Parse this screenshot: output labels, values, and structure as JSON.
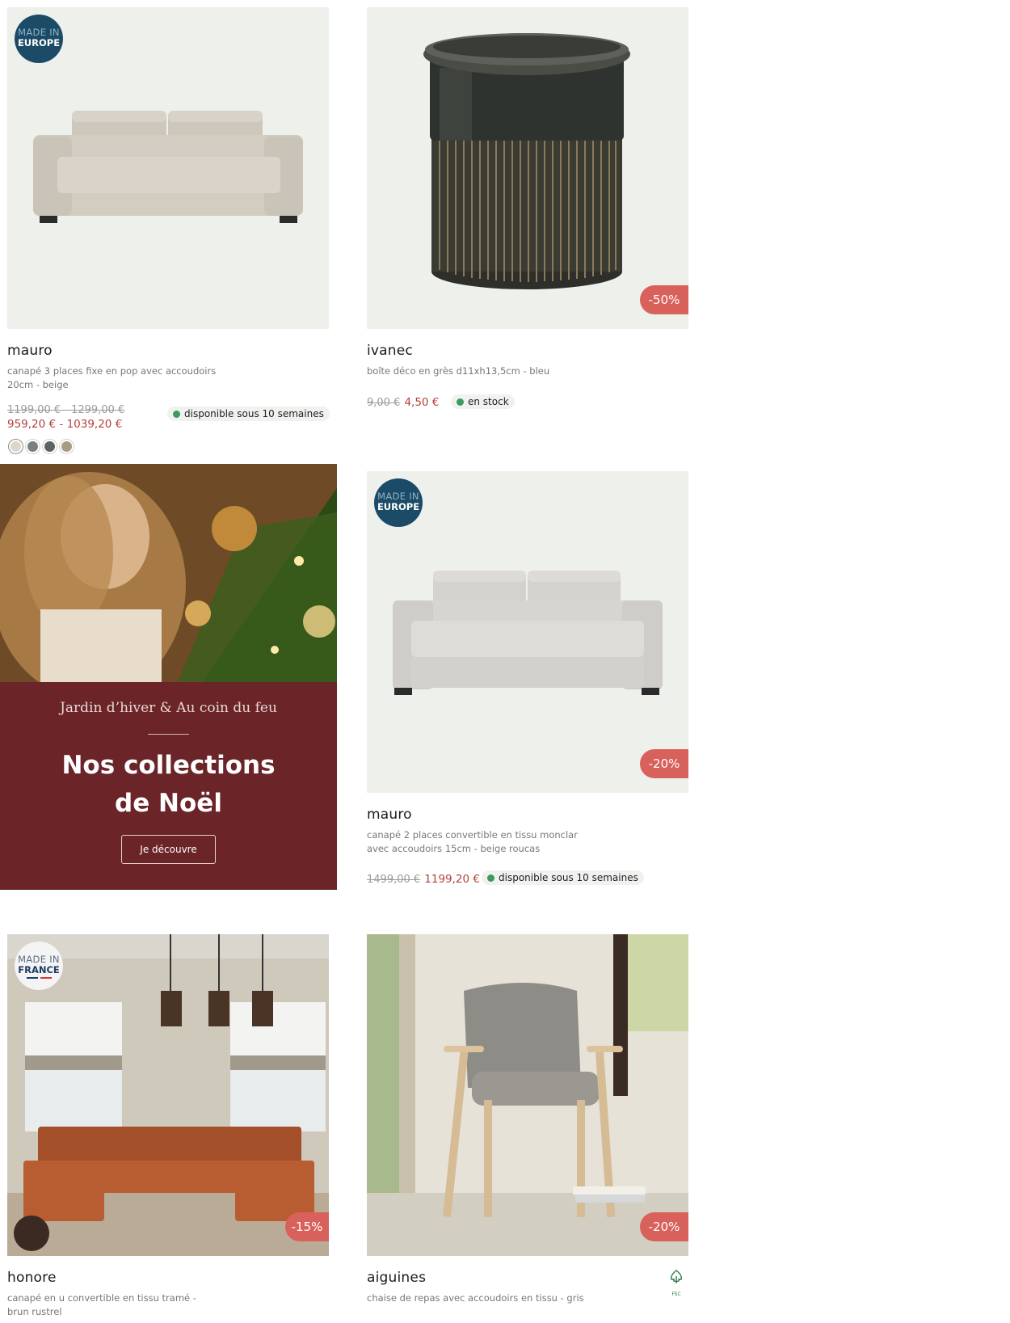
{
  "products": [
    {
      "name": "mauro",
      "description": "canapé 3 places fixe en pop avec accoudoirs 20cm - beige",
      "badge": {
        "line1": "MADE IN",
        "line2": "EUROPE"
      },
      "old_price": "1199,00 € - 1299,00 €",
      "new_price": "959,20 € - 1039,20 €",
      "availability": "disponible sous 10 semaines",
      "swatches": [
        "#ddd6c9",
        "#7a7f80",
        "#5f6261",
        "#a89a84"
      ]
    },
    {
      "name": "ivanec",
      "description": "boîte déco en grès d11xh13,5cm - bleu",
      "discount": "-50%",
      "old_price": "9,00 €",
      "new_price": "4,50 €",
      "availability": "en stock"
    },
    {
      "name": "mauro",
      "description": "canapé 2 places convertible en tissu monclar avec accoudoirs 15cm - beige roucas",
      "badge": {
        "line1": "MADE IN",
        "line2": "EUROPE"
      },
      "discount": "-20%",
      "old_price": "1499,00 €",
      "new_price": "1199,20 €",
      "availability": "disponible sous 10 semaines"
    },
    {
      "name": "honore",
      "description": "canapé en u convertible en tissu tramé - brun rustrel",
      "badge": {
        "line1": "MADE IN",
        "line2": "FRANCE"
      },
      "discount": "-15%"
    },
    {
      "name": "aiguines",
      "description": "chaise de repas avec accoudoirs en tissu - gris",
      "discount": "-20%",
      "certification": "FSC"
    }
  ],
  "promo": {
    "kicker": "Jardin d’hiver & Au coin du feu",
    "title_line1": "Nos collections",
    "title_line2": "de Noël",
    "button": "Je découvre"
  },
  "colors": {
    "price_red": "#b5403a",
    "discount_bg": "#d9615b",
    "badge_blue": "#1b4b66",
    "promo_bg": "#6b2428",
    "stock_green": "#3c9a5f"
  }
}
